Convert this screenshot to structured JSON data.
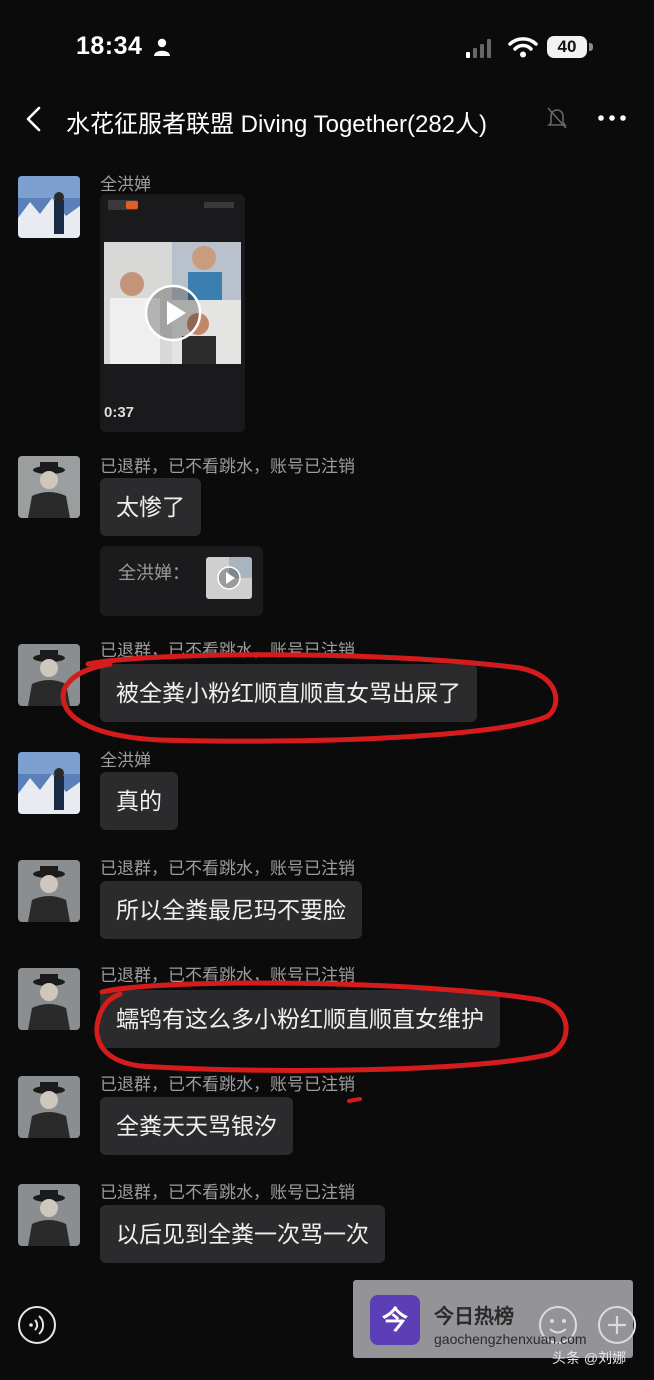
{
  "status_bar": {
    "time": "18:34",
    "battery": "40"
  },
  "header": {
    "title": "水花征服者联盟 Diving Together(282人)"
  },
  "video": {
    "duration": "0:37"
  },
  "messages": [
    {
      "sender": "全洪婵"
    },
    {
      "sender": "已退群，已不看跳水，账号已注销",
      "text": "太惨了",
      "quote": "全洪婵："
    },
    {
      "sender": "已退群，已不看跳水，账号已注销",
      "text": "被全粪小粉红顺直顺直女骂出屎了"
    },
    {
      "sender": "全洪婵",
      "text": "真的"
    },
    {
      "sender": "已退群，已不看跳水，账号已注销",
      "text": "所以全粪最尼玛不要脸"
    },
    {
      "sender": "已退群，已不看跳水，账号已注销",
      "text": "蠕鸨有这么多小粉红顺直顺直女维护"
    },
    {
      "sender": "已退群，已不看跳水，账号已注销",
      "text": "全粪天天骂银汐"
    },
    {
      "sender": "已退群，已不看跳水，账号已注销",
      "text": "以后见到全粪一次骂一次"
    }
  ],
  "watermark": {
    "title": "今日热榜",
    "url": "gaochengzhenxuan.com",
    "logo_glyph": "今"
  },
  "credit": "头条 @刘娜",
  "colors": {
    "background": "#0b0b0c",
    "bubble": "#2b2b2d",
    "annotation_red": "#d51c1c"
  }
}
